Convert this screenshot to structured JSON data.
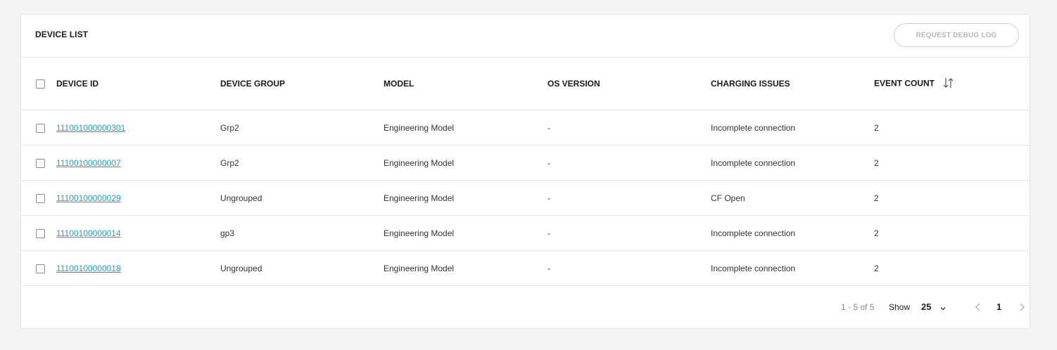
{
  "header": {
    "title": "DEVICE LIST",
    "debug_button_label": "REQUEST DEBUG LOG"
  },
  "table": {
    "columns": {
      "device_id": "DEVICE ID",
      "device_group": "DEVICE GROUP",
      "model": "MODEL",
      "os_version": "OS VERSION",
      "charging_issues": "CHARGING ISSUES",
      "event_count": "EVENT COUNT"
    },
    "rows": [
      {
        "device_id": "111001000000301",
        "device_group": "Grp2",
        "model": "Engineering Model",
        "os_version": "-",
        "charging_issues": "Incomplete connection",
        "event_count": "2"
      },
      {
        "device_id": "11100100000007",
        "device_group": "Grp2",
        "model": "Engineering Model",
        "os_version": "-",
        "charging_issues": "Incomplete connection",
        "event_count": "2"
      },
      {
        "device_id": "11100100000029",
        "device_group": "Ungrouped",
        "model": "Engineering Model",
        "os_version": "-",
        "charging_issues": "CF Open",
        "event_count": "2"
      },
      {
        "device_id": "11100100000014",
        "device_group": "gp3",
        "model": "Engineering Model",
        "os_version": "-",
        "charging_issues": "Incomplete connection",
        "event_count": "2"
      },
      {
        "device_id": "11100100000018",
        "device_group": "Ungrouped",
        "model": "Engineering Model",
        "os_version": "-",
        "charging_issues": "Incomplete connection",
        "event_count": "2"
      }
    ]
  },
  "footer": {
    "range": "1 - 5 of 5",
    "show_label": "Show",
    "page_size": "25",
    "current_page": "1"
  },
  "icons": {
    "sort": "sort-icon",
    "page_size_dropdown": "chevron-down-icon",
    "prev_page": "chevron-left-icon",
    "next_page": "chevron-right-icon"
  },
  "colors": {
    "link": "#1ba0d6",
    "disabled_button_text": "#b9b9b9",
    "page_background": "#f4f4f4"
  }
}
